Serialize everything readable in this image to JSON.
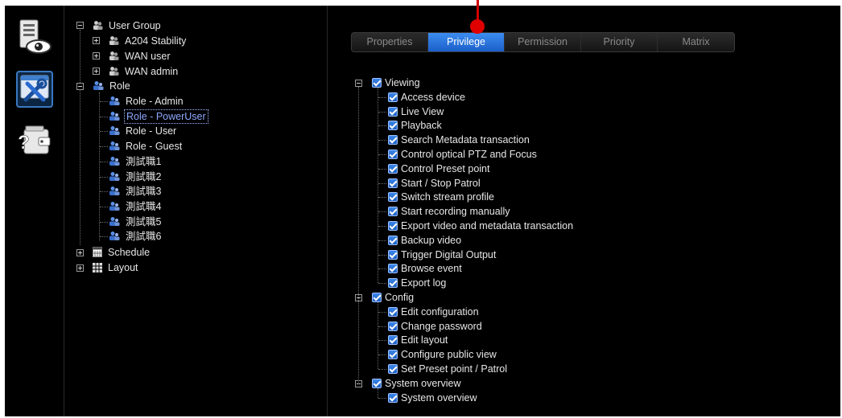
{
  "nav": {
    "items": [
      {
        "icon": "monitor-eye-icon"
      },
      {
        "icon": "settings-tools-icon",
        "active": true
      },
      {
        "icon": "help-wallet-icon"
      }
    ]
  },
  "tree": {
    "user_group": "User Group",
    "groups": [
      "A204 Stability",
      "WAN user",
      "WAN admin"
    ],
    "role": "Role",
    "roles": [
      "Role - Admin",
      "Role - PowerUser",
      "Role - User",
      "Role - Guest",
      "測試職1",
      "測試職2",
      "測試職3",
      "測試職4",
      "測試職5",
      "測試職6"
    ],
    "selected_role": "Role - PowerUser",
    "schedule": "Schedule",
    "layout": "Layout"
  },
  "tabs": [
    "Properties",
    "Privilege",
    "Permission",
    "Priority",
    "Matrix"
  ],
  "active_tab": "Privilege",
  "privileges": [
    {
      "name": "Viewing",
      "checked": true,
      "items": [
        "Access device",
        "Live View",
        "Playback",
        "Search Metadata transaction",
        "Control optical PTZ and Focus",
        "Control Preset point",
        "Start / Stop Patrol",
        "Switch stream profile",
        "Start recording manually",
        "Export video and metadata transaction",
        "Backup video",
        "Trigger Digital Output",
        "Browse event",
        "Export log"
      ]
    },
    {
      "name": "Config",
      "checked": true,
      "items": [
        "Edit configuration",
        "Change password",
        "Edit layout",
        "Configure public view",
        "Set Preset point / Patrol"
      ]
    },
    {
      "name": "System overview",
      "checked": true,
      "items": [
        "System overview"
      ]
    }
  ],
  "colors": {
    "background": "#000000",
    "accent": "#2a73dc",
    "tab_active": "#3c8df0",
    "marker": "#e00000",
    "selected_text": "#8fa8ff"
  }
}
